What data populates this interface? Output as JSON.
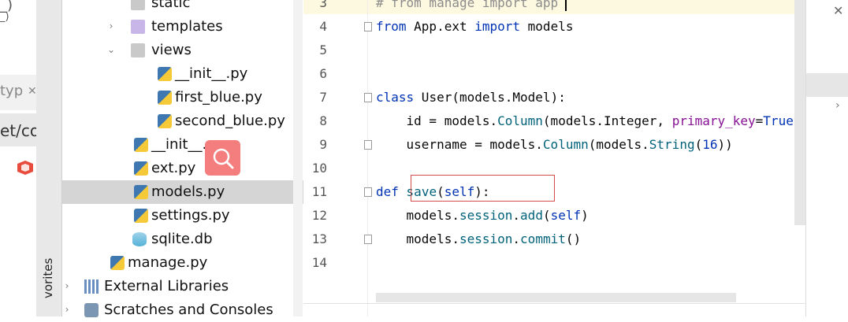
{
  "left_fragment": {
    "texts": [
      "_)",
      "_)",
      "typ",
      "et/co"
    ],
    "close_icon": "✕"
  },
  "favorites_label": "vorites",
  "tree": [
    {
      "label": "static",
      "icon": "folder-icon",
      "arrow": ""
    },
    {
      "label": "templates",
      "icon": "folder-purple-icon",
      "arrow": "›"
    },
    {
      "label": "views",
      "icon": "folder-icon",
      "arrow": "⌄"
    },
    {
      "label": "__init__.py",
      "icon": "python-file-icon",
      "arrow": ""
    },
    {
      "label": "first_blue.py",
      "icon": "python-file-icon",
      "arrow": ""
    },
    {
      "label": "second_blue.py",
      "icon": "python-file-icon",
      "arrow": ""
    },
    {
      "label": "__init__.py",
      "icon": "python-file-icon",
      "arrow": ""
    },
    {
      "label": "ext.py",
      "icon": "python-file-icon",
      "arrow": ""
    },
    {
      "label": "models.py",
      "icon": "python-file-icon",
      "arrow": "",
      "selected": true
    },
    {
      "label": "settings.py",
      "icon": "python-file-icon",
      "arrow": ""
    },
    {
      "label": "sqlite.db",
      "icon": "database-icon",
      "arrow": ""
    },
    {
      "label": "manage.py",
      "icon": "python-file-icon",
      "arrow": ""
    },
    {
      "label": "External Libraries",
      "icon": "library-icon",
      "arrow": "›"
    },
    {
      "label": "Scratches and Consoles",
      "icon": "scratch-icon",
      "arrow": "›"
    }
  ],
  "editor": {
    "line_numbers": [
      "3",
      "4",
      "5",
      "6",
      "7",
      "8",
      "9",
      "10",
      "11",
      "12",
      "13",
      "14"
    ],
    "lines": [
      "# from manage import app",
      "from App.ext import models",
      "",
      "",
      "class User(models.Model):",
      "    id = models.Column(models.Integer, primary_key=True",
      "    username = models.Column(models.String(16))",
      "",
      "def save(self):",
      "    models.session.add(self)",
      "    models.session.commit()",
      ""
    ]
  },
  "right_fragment": {
    "close_icon": "✕",
    "chevron": "›"
  }
}
